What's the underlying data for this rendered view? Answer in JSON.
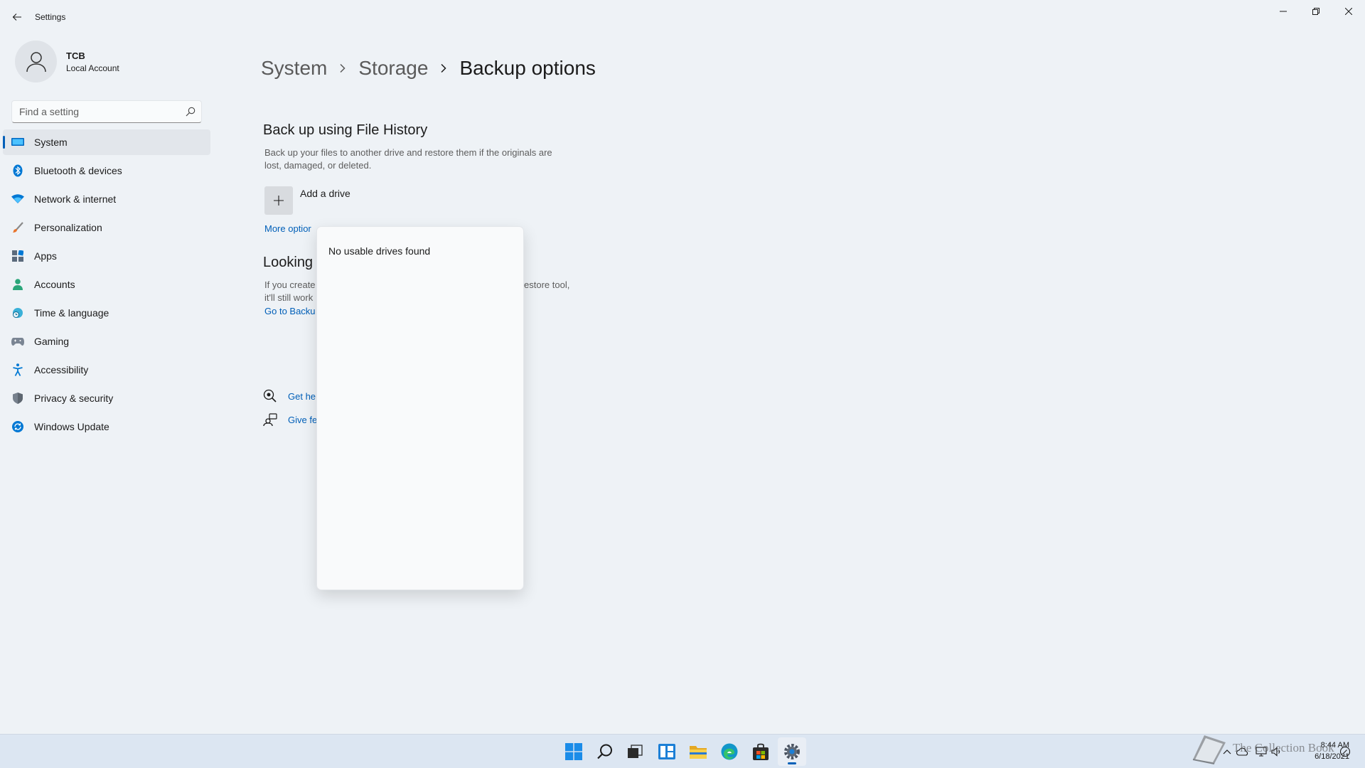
{
  "window": {
    "title": "Settings",
    "controls": [
      "minimize",
      "restore",
      "close"
    ]
  },
  "profile": {
    "name": "TCB",
    "account_type": "Local Account"
  },
  "search": {
    "placeholder": "Find a setting"
  },
  "nav": {
    "items": [
      {
        "label": "System",
        "icon": "system-icon",
        "selected": true
      },
      {
        "label": "Bluetooth & devices",
        "icon": "bluetooth-icon"
      },
      {
        "label": "Network & internet",
        "icon": "wifi-icon"
      },
      {
        "label": "Personalization",
        "icon": "brush-icon"
      },
      {
        "label": "Apps",
        "icon": "apps-icon"
      },
      {
        "label": "Accounts",
        "icon": "person-icon"
      },
      {
        "label": "Time & language",
        "icon": "globe-clock-icon"
      },
      {
        "label": "Gaming",
        "icon": "gamepad-icon"
      },
      {
        "label": "Accessibility",
        "icon": "accessibility-icon"
      },
      {
        "label": "Privacy & security",
        "icon": "shield-icon"
      },
      {
        "label": "Windows Update",
        "icon": "update-icon"
      }
    ]
  },
  "breadcrumb": {
    "level1": "System",
    "level2": "Storage",
    "current": "Backup options"
  },
  "file_history": {
    "title": "Back up using File History",
    "description_line1": "Back up your files to another drive and restore them if the originals are",
    "description_line2": "lost, damaged, or deleted.",
    "add_drive_label": "Add a drive",
    "more_options_link": "More optior"
  },
  "older_backup": {
    "title_visible": "Looking",
    "line1_left": "If you create",
    "line1_right": "estore tool,",
    "line2_left": "it'll still work",
    "link_visible": "Go to Backu"
  },
  "help": {
    "get_help_visible": "Get he",
    "give_feedback_visible": "Give fe"
  },
  "flyout": {
    "message": "No usable drives found"
  },
  "taskbar": {
    "apps": [
      "start-icon",
      "search-icon",
      "task-view-icon",
      "widgets-icon",
      "file-explorer-icon",
      "edge-icon",
      "store-icon",
      "settings-icon"
    ],
    "active_app": "settings-icon",
    "accent": "#005fb8"
  },
  "tray": {
    "time": "8:44 AM",
    "date": "6/18/2021"
  },
  "watermark": {
    "text": "The Collection Book"
  },
  "colors": {
    "background": "#eef2f6",
    "accent": "#005fb8",
    "link": "#005fb8"
  }
}
